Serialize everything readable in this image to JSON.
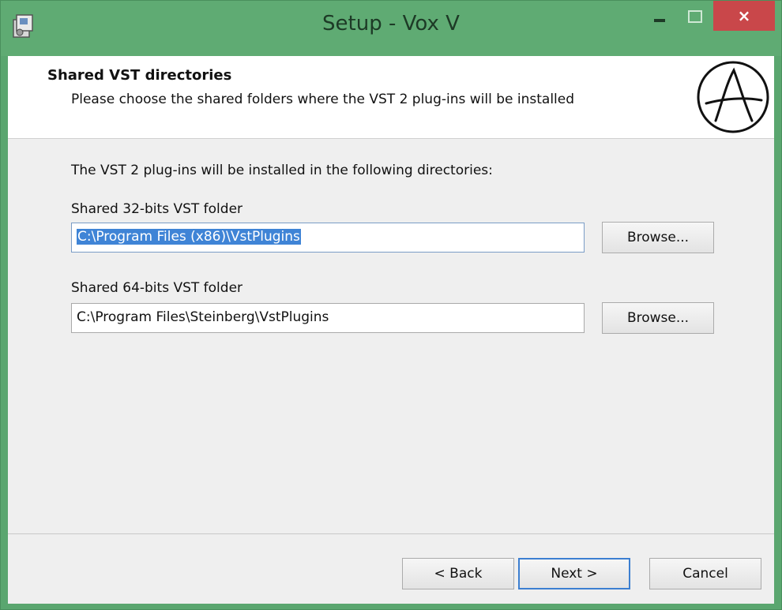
{
  "window": {
    "title": "Setup - Vox V",
    "close_glyph": "×",
    "icon": "installer-icon",
    "accent_color": "#5fab73",
    "close_color": "#c9474a"
  },
  "header": {
    "title": "Shared VST directories",
    "subtitle": "Please choose the shared folders where the VST 2 plug-ins will be installed",
    "logo_icon": "circle-a-logo"
  },
  "content": {
    "intro": "The VST 2 plug-ins will be installed in the following directories:",
    "folder32": {
      "label": "Shared 32-bits VST folder",
      "value": "C:\\Program Files (x86)\\VstPlugins",
      "browse_label": "Browse..."
    },
    "folder64": {
      "label": "Shared 64-bits VST folder",
      "value": "C:\\Program Files\\Steinberg\\VstPlugins",
      "browse_label": "Browse..."
    }
  },
  "footer": {
    "back_label": "< Back",
    "next_label": "Next >",
    "cancel_label": "Cancel"
  }
}
